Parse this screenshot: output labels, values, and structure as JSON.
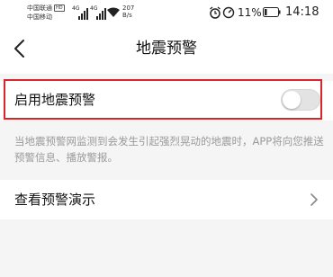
{
  "status_bar": {
    "carrier1": "中国联通",
    "carrier1_tag": "HD",
    "carrier2": "中国移动",
    "net_type1": "4G",
    "net_type2": "4G",
    "net_speed": "207",
    "net_speed_unit": "B/s",
    "battery_percent": "11%",
    "time": "14:18",
    "icons": [
      "signal-icon",
      "wifi-icon",
      "alarm-icon",
      "speed-gauge-icon",
      "battery-icon"
    ]
  },
  "nav": {
    "title": "地震预警",
    "back_icon": "chevron-left-icon"
  },
  "settings": {
    "toggle_label": "启用地震预警",
    "toggle_on": false,
    "description": "当地震预警网监测到会发生引起强烈晃动的地震时，APP将向您推送预警信息、播放警报。",
    "demo_label": "查看预警演示",
    "demo_icon": "chevron-right-icon"
  },
  "colors": {
    "highlight": "#d8252b",
    "background": "#f5f5f5",
    "text_primary": "#111111",
    "text_secondary": "#9a9a9a"
  }
}
